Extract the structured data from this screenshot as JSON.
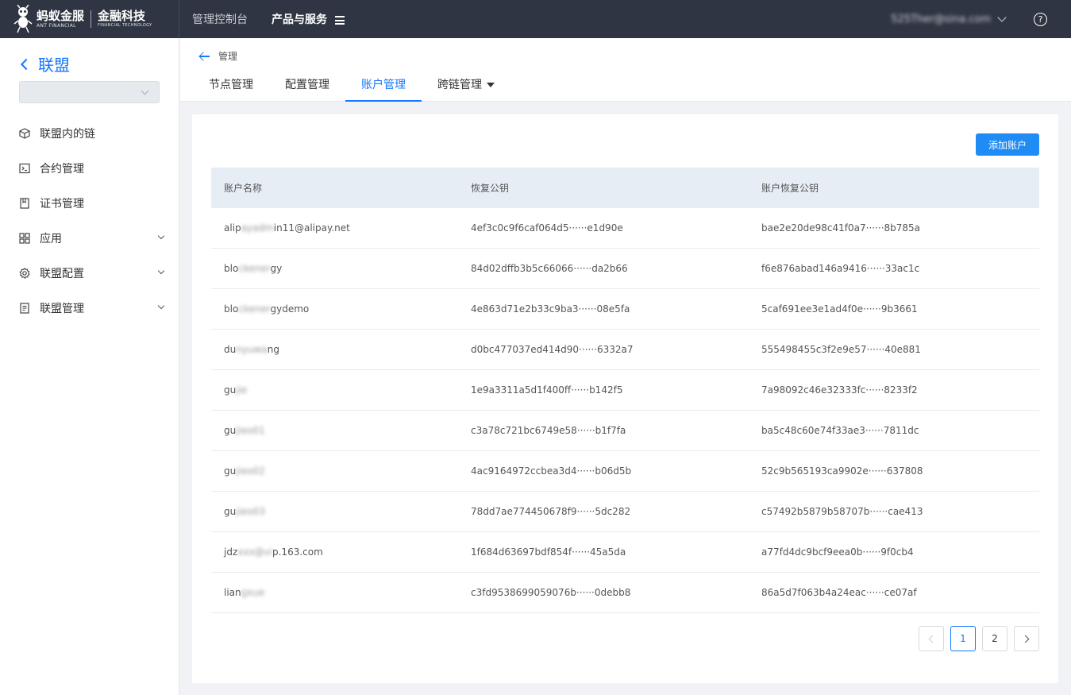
{
  "brand": {
    "name_cn": "蚂蚁金服",
    "name_en": "ANT FINANCIAL",
    "sub_cn": "金融科技",
    "sub_en": "FINANCIAL TECHNOLOGY"
  },
  "top_nav": {
    "items": [
      {
        "label": "管理控制台"
      },
      {
        "label": "产品与服务"
      }
    ],
    "user_email": "525Ther@sina.com",
    "help_label": "?"
  },
  "sidebar": {
    "title": "联盟",
    "select_value": "",
    "items": [
      {
        "label": "联盟内的链",
        "icon": "cube-icon"
      },
      {
        "label": "合约管理",
        "icon": "terminal-icon"
      },
      {
        "label": "证书管理",
        "icon": "bookmark-icon"
      },
      {
        "label": "应用",
        "icon": "grid-icon"
      },
      {
        "label": "联盟配置",
        "icon": "gear-icon"
      },
      {
        "label": "联盟管理",
        "icon": "list-icon"
      }
    ]
  },
  "header": {
    "breadcrumb": "管理",
    "tabs": [
      {
        "label": "节点管理"
      },
      {
        "label": "配置管理"
      },
      {
        "label": "账户管理"
      },
      {
        "label": "跨链管理"
      }
    ]
  },
  "card": {
    "add_button": "添加账户",
    "columns": [
      "账户名称",
      "恢复公钥",
      "账户恢复公钥"
    ],
    "rows": [
      {
        "name_a": "alip",
        "name_b": "ayadm",
        "name_c": "in11@alipay.net",
        "recover_key": "4ef3c0c9f6caf064d5······e1d90e",
        "account_key": "bae2e20de98c41f0a7······8b785a"
      },
      {
        "name_a": "blo",
        "name_b": "ckener",
        "name_c": "gy",
        "recover_key": "84d02dffb3b5c66066······da2b66",
        "account_key": "f6e876abad146a9416······33ac1c"
      },
      {
        "name_a": "blo",
        "name_b": "ckener",
        "name_c": "gydemo",
        "recover_key": "4e863d71e2b33c9ba3······08e5fa",
        "account_key": "5caf691ee3e1ad4f0e······9b3661"
      },
      {
        "name_a": "du",
        "name_b": "nyuwa",
        "name_c": "ng",
        "recover_key": "d0bc477037ed414d90······6332a7",
        "account_key": "555498455c3f2e9e57······40e881"
      },
      {
        "name_a": "gu",
        "name_b": "jie",
        "name_c": "",
        "recover_key": "1e9a3311a5d1f400ff······b142f5",
        "account_key": "7a98092c46e32333fc······8233f2"
      },
      {
        "name_a": "gu",
        "name_b": "jieo01",
        "name_c": "",
        "recover_key": "c3a78c721bc6749e58······b1f7fa",
        "account_key": "ba5c48c60e74f33ae3······7811dc"
      },
      {
        "name_a": "gu",
        "name_b": "jieo02",
        "name_c": "",
        "recover_key": "4ac9164972ccbea3d4······b06d5b",
        "account_key": "52c9b565193ca9902e······637808"
      },
      {
        "name_a": "gu",
        "name_b": "jieo03",
        "name_c": "",
        "recover_key": "78dd7ae774450678f9······5dc282",
        "account_key": "c57492b5879b58707b······cae413"
      },
      {
        "name_a": "jdz",
        "name_b": "xxx@vi",
        "name_c": "p.163.com",
        "recover_key": "1f684d63697bdf854f······45a5da",
        "account_key": "a77fd4dc9bcf9eea0b······9f0cb4"
      },
      {
        "name_a": "lian",
        "name_b": "gxue",
        "name_c": "",
        "recover_key": "c3fd9538699059076b······0debb8",
        "account_key": "86a5d7f063b4a24eac······ce07af"
      }
    ]
  },
  "pagination": {
    "pages": [
      "1",
      "2"
    ],
    "current": "1"
  }
}
